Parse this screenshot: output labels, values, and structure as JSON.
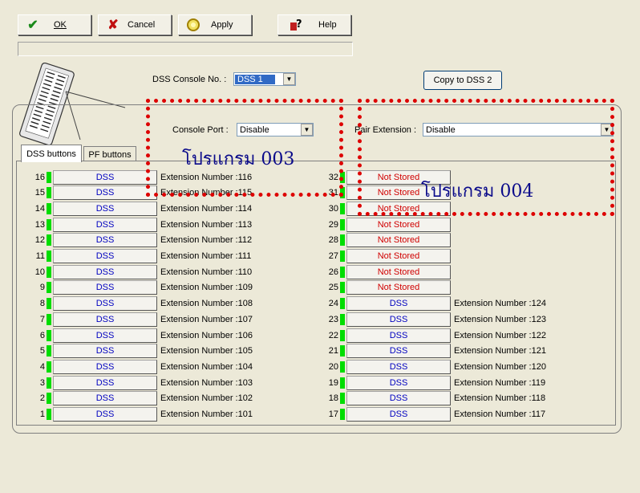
{
  "toolbar": {
    "ok_label": "OK",
    "cancel_label": "Cancel",
    "apply_label": "Apply",
    "help_label": "Help"
  },
  "console": {
    "console_no_label": "DSS Console No. :",
    "console_no_value": "DSS 1",
    "copy_button": "Copy to DSS 2",
    "console_port_label": "Console Port :",
    "console_port_value": "Disable",
    "pair_extension_label": "Pair Extension :",
    "pair_extension_value": "Disable"
  },
  "tabs": [
    "DSS buttons",
    "PF buttons"
  ],
  "annotations": {
    "program_003": "โปรแกรม 003",
    "program_004": "โปรแกรม 004"
  },
  "left_column": [
    {
      "num": "16",
      "button": "DSS",
      "ext": "Extension Number :116"
    },
    {
      "num": "15",
      "button": "DSS",
      "ext": "Extension Number :115"
    },
    {
      "num": "14",
      "button": "DSS",
      "ext": "Extension Number :114"
    },
    {
      "num": "13",
      "button": "DSS",
      "ext": "Extension Number :113"
    },
    {
      "num": "12",
      "button": "DSS",
      "ext": "Extension Number :112"
    },
    {
      "num": "11",
      "button": "DSS",
      "ext": "Extension Number :111"
    },
    {
      "num": "10",
      "button": "DSS",
      "ext": "Extension Number :110"
    },
    {
      "num": "9",
      "button": "DSS",
      "ext": "Extension Number :109"
    },
    {
      "num": "8",
      "button": "DSS",
      "ext": "Extension Number :108"
    },
    {
      "num": "7",
      "button": "DSS",
      "ext": "Extension Number :107"
    },
    {
      "num": "6",
      "button": "DSS",
      "ext": "Extension Number :106"
    },
    {
      "num": "5",
      "button": "DSS",
      "ext": "Extension Number :105"
    },
    {
      "num": "4",
      "button": "DSS",
      "ext": "Extension Number :104"
    },
    {
      "num": "3",
      "button": "DSS",
      "ext": "Extension Number :103"
    },
    {
      "num": "2",
      "button": "DSS",
      "ext": "Extension Number :102"
    },
    {
      "num": "1",
      "button": "DSS",
      "ext": "Extension Number :101"
    }
  ],
  "right_column": [
    {
      "num": "32",
      "button": "Not Stored",
      "ext": ""
    },
    {
      "num": "31",
      "button": "Not Stored",
      "ext": ""
    },
    {
      "num": "30",
      "button": "Not Stored",
      "ext": ""
    },
    {
      "num": "29",
      "button": "Not Stored",
      "ext": ""
    },
    {
      "num": "28",
      "button": "Not Stored",
      "ext": ""
    },
    {
      "num": "27",
      "button": "Not Stored",
      "ext": ""
    },
    {
      "num": "26",
      "button": "Not Stored",
      "ext": ""
    },
    {
      "num": "25",
      "button": "Not Stored",
      "ext": ""
    },
    {
      "num": "24",
      "button": "DSS",
      "ext": "Extension Number :124"
    },
    {
      "num": "23",
      "button": "DSS",
      "ext": "Extension Number :123"
    },
    {
      "num": "22",
      "button": "DSS",
      "ext": "Extension Number :122"
    },
    {
      "num": "21",
      "button": "DSS",
      "ext": "Extension Number :121"
    },
    {
      "num": "20",
      "button": "DSS",
      "ext": "Extension Number :120"
    },
    {
      "num": "19",
      "button": "DSS",
      "ext": "Extension Number :119"
    },
    {
      "num": "18",
      "button": "DSS",
      "ext": "Extension Number :118"
    },
    {
      "num": "17",
      "button": "DSS",
      "ext": "Extension Number :117"
    }
  ],
  "colors": {
    "led": "#00dd00",
    "dss_text": "#0000c0",
    "not_stored_text": "#d00000",
    "annotation_box": "#dd0000",
    "annotation_text": "#0a0a8a"
  }
}
